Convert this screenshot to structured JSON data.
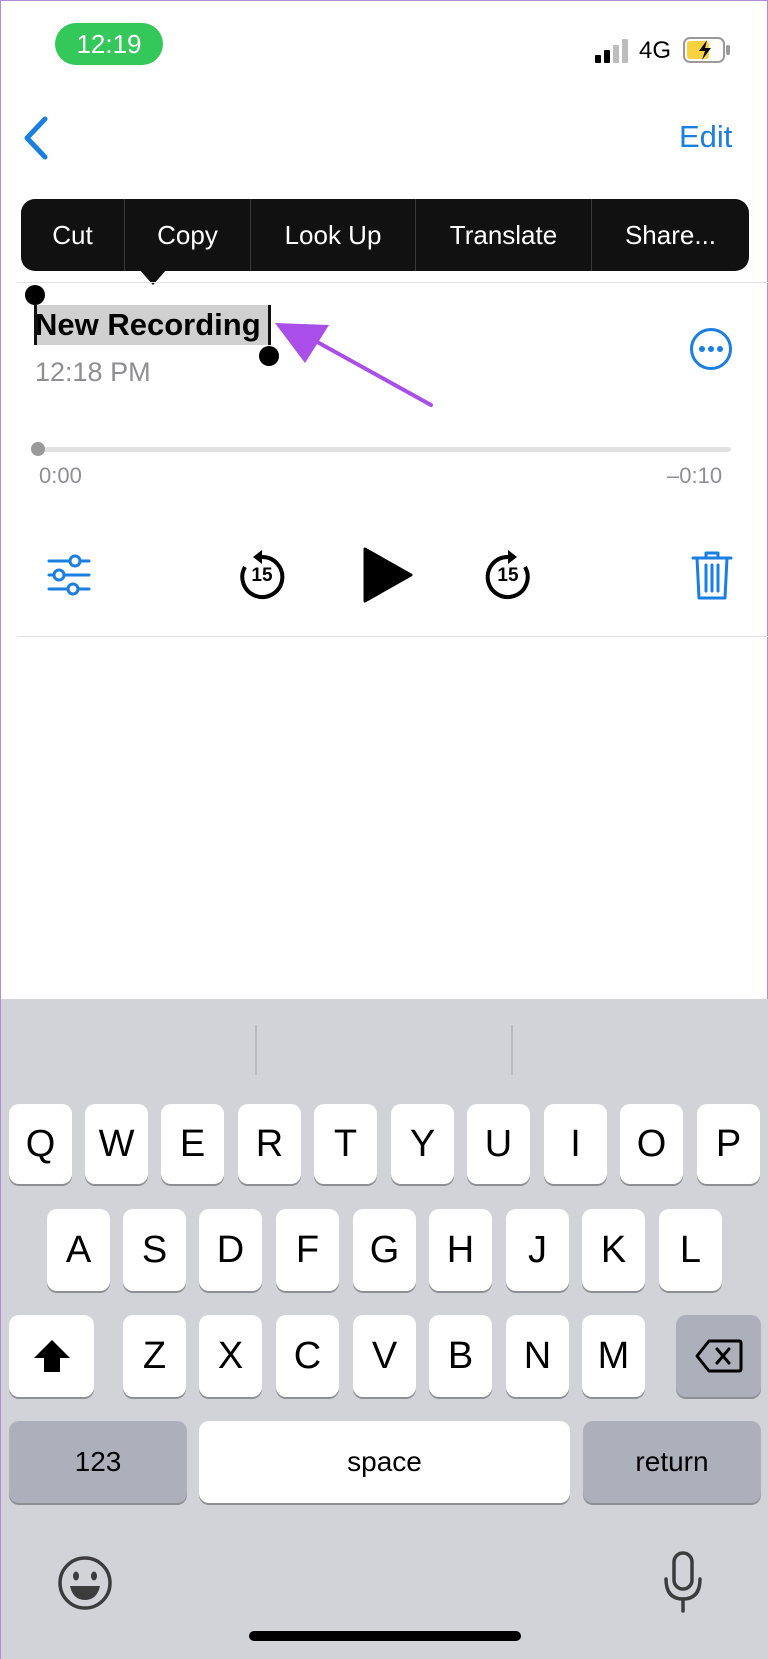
{
  "status_bar": {
    "time": "12:19",
    "network": "4G",
    "pill_color": "#34c759",
    "battery_color": "#f7d23e"
  },
  "nav": {
    "back_icon": "chevron-left-icon",
    "edit_label": "Edit",
    "accent": "#1a7fe0"
  },
  "context_menu": {
    "items": [
      "Cut",
      "Copy",
      "Look Up",
      "Translate",
      "Share..."
    ]
  },
  "recording": {
    "title": "New Recording",
    "date": "12:18 PM",
    "more_icon": "ellipsis-circle-icon",
    "progress": {
      "value": 0,
      "elapsed": "0:00",
      "remaining": "–0:10"
    }
  },
  "controls": {
    "settings_icon": "sliders-icon",
    "skip_back_label": "15",
    "play_icon": "play-icon",
    "skip_forward_label": "15",
    "trash_icon": "trash-icon"
  },
  "annotation": {
    "color": "#a94ee8"
  },
  "keyboard": {
    "row1": [
      "Q",
      "W",
      "E",
      "R",
      "T",
      "Y",
      "U",
      "I",
      "O",
      "P"
    ],
    "row2": [
      "A",
      "S",
      "D",
      "F",
      "G",
      "H",
      "J",
      "K",
      "L"
    ],
    "row3": [
      "Z",
      "X",
      "C",
      "V",
      "B",
      "N",
      "M"
    ],
    "numbers_label": "123",
    "space_label": "space",
    "return_label": "return",
    "shift_icon": "shift-icon",
    "delete_icon": "delete-backward-icon",
    "emoji_icon": "emoji-icon",
    "mic_icon": "microphone-icon"
  }
}
